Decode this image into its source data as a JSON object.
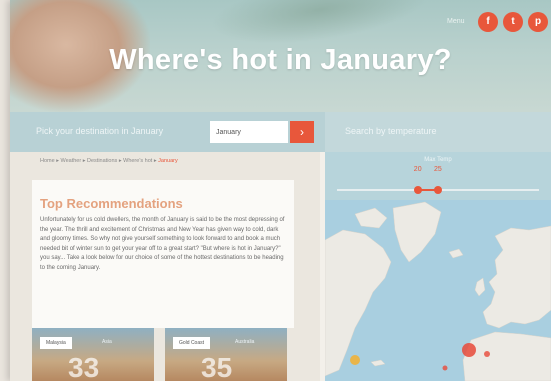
{
  "hero": {
    "title": "Where's hot in January?",
    "top_link": "Menu",
    "social": [
      {
        "icon": "facebook-icon",
        "glyph": "f"
      },
      {
        "icon": "twitter-icon",
        "glyph": "t"
      },
      {
        "icon": "pinterest-icon",
        "glyph": "p"
      }
    ]
  },
  "search": {
    "label": "Pick your destination in January",
    "month_value": "January",
    "button_glyph": "›",
    "right_label": "Search by temperature"
  },
  "breadcrumb": {
    "items": [
      "Home",
      "Weather",
      "Destinations",
      "Where's hot",
      "January"
    ],
    "separator": "▸"
  },
  "recommendations": {
    "title": "Top Recommendations",
    "body": "Unfortunately for us cold dwellers, the month of January is said to be the most depressing of the year. The thrill and excitement of Christmas and New Year has given way to cold, dark and gloomy times. So why not give yourself something to look forward to and book a much needed bit of winter sun to get your year off to a great start? \"But where is hot in January?\" you say... Take a look below for our choice of some of the hottest destinations to be heading to the coming January."
  },
  "destinations": [
    {
      "name": "Malaysia",
      "sub": "Asia",
      "temp": "33"
    },
    {
      "name": "Gold Coast",
      "sub": "Australia",
      "temp": "35"
    }
  ],
  "slider": {
    "title": "Max Temp",
    "min_label": "20",
    "max_label": "25",
    "min": 0,
    "max": 50,
    "low": 20,
    "high": 25
  },
  "colors": {
    "accent": "#e8573b",
    "title": "#e4a27f",
    "sea": "#a9cfe0",
    "land": "#eceae4"
  }
}
